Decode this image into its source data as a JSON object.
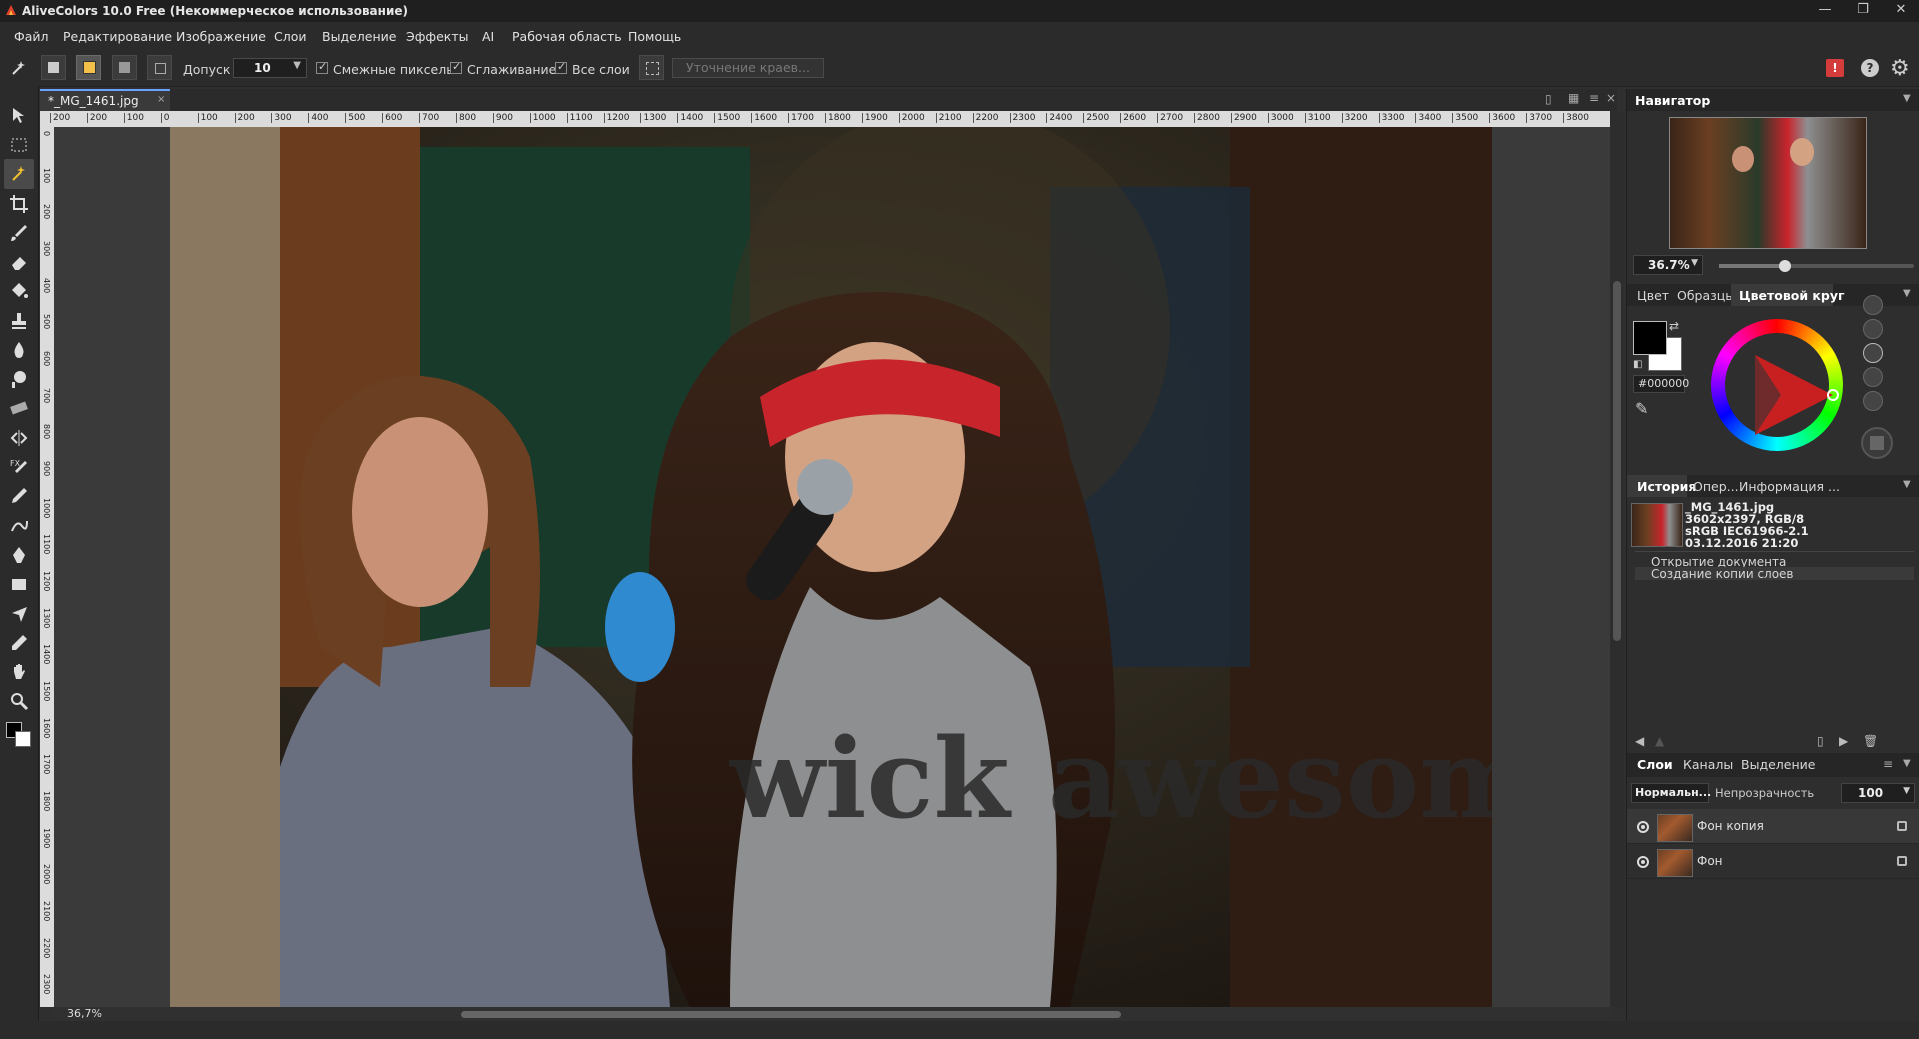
{
  "window": {
    "title": "AliveColors 10.0 Free (Некоммерческое использование)",
    "controls": [
      "—",
      "❐",
      "✕"
    ]
  },
  "menu": [
    "Файл",
    "Редактирование",
    "Изображение",
    "Слои",
    "Выделение",
    "Эффекты",
    "AI",
    "Рабочая область",
    "Помощь"
  ],
  "options": {
    "tolerance_label": "Допуск",
    "tolerance_value": "10",
    "contiguous_label": "Смежные пикселы",
    "antialias_label": "Сглаживание",
    "all_layers_label": "Все слои",
    "refine_edges_label": "Уточнение краев..."
  },
  "document": {
    "tab_label": "*_MG_1461.jpg",
    "zoom_status": "36,7%",
    "ruler_top": [
      "200",
      "200",
      "100",
      "0",
      "100",
      "200",
      "300",
      "400",
      "500",
      "600",
      "700",
      "800",
      "900",
      "1000",
      "1100",
      "1200",
      "1300",
      "1400",
      "1500",
      "1600",
      "1700",
      "1800",
      "1900",
      "2000",
      "2100",
      "2200",
      "2300",
      "2400",
      "2500",
      "2600",
      "2700",
      "2800",
      "2900",
      "3000",
      "3100",
      "3200",
      "3300",
      "3400",
      "3500",
      "3600",
      "3700",
      "3800"
    ],
    "ruler_left": [
      "0",
      "100",
      "200",
      "300",
      "400",
      "500",
      "600",
      "700",
      "800",
      "900",
      "1000",
      "1100",
      "1200",
      "1300",
      "1400",
      "1500",
      "1600",
      "1700",
      "1800",
      "1900",
      "2000",
      "2100",
      "2200",
      "2300"
    ],
    "photo_text": "wick awesome"
  },
  "navigator": {
    "title": "Навигатор",
    "zoom": "36.7%",
    "zoom_slider_fraction": 0.34
  },
  "color_panel": {
    "tabs": [
      "Цвет",
      "Образцы",
      "Цветовой круг"
    ],
    "active_tab": 2,
    "hex": "#000000",
    "foreground": "#000000",
    "background": "#ffffff"
  },
  "history_panel": {
    "tabs": [
      "История",
      "Опер...",
      "Информация ..."
    ],
    "doc_name": "_MG_1461.jpg",
    "doc_size": "3602x2397, RGB/8",
    "doc_profile": "sRGB IEC61966-2.1",
    "doc_date": "03.12.2016 21:20",
    "items": [
      "Открытие документа",
      "Создание копии слоев"
    ]
  },
  "layers_panel": {
    "tabs": [
      "Слои",
      "Каналы",
      "Выделение"
    ],
    "blend_mode": "Нормальн...",
    "opacity_label": "Непрозрачность",
    "opacity_value": "100",
    "layers": [
      {
        "name": "Фон копия"
      },
      {
        "name": "Фон"
      }
    ]
  }
}
